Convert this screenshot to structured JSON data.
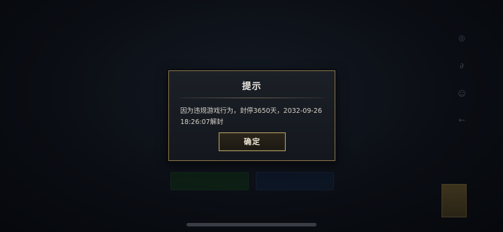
{
  "modal": {
    "title": "提示",
    "message": "因为违规游戏行为，封停3650天，2032-09-26 18:26:07解封",
    "confirm_label": "确定"
  }
}
